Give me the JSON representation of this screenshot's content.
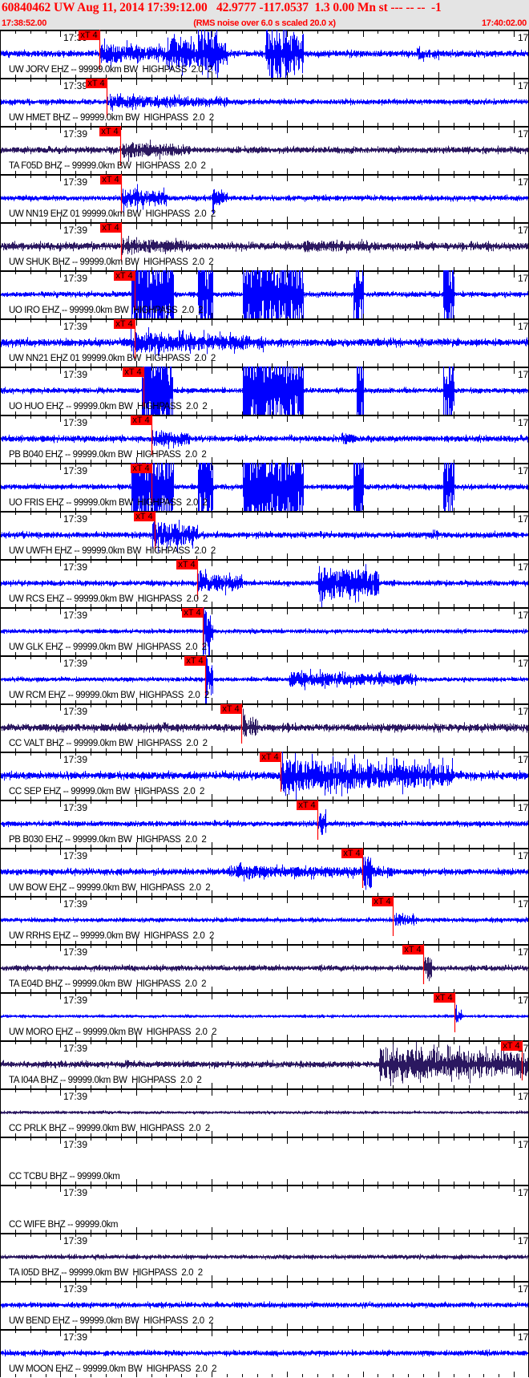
{
  "header": {
    "title": "60840462 UW Aug 11, 2014 17:39:12.00   42.9777 -117.0537  1.3 0.00 Mn st --- -- --  -1",
    "start_time": "17:38:52.00",
    "end_time": "17:40:02.00",
    "rms_note": "(RMS noise over 6.0 s scaled 20.0 x)"
  },
  "colors": {
    "blue": "#0000ff",
    "dark": "#2b1860",
    "pick": "#ff0000",
    "header_bg": "#e4e4e4"
  },
  "chart_data": {
    "type": "line",
    "title": "60840462 UW Aug 11, 2014 17:39:12.00",
    "x_range_seconds": [
      0,
      70
    ],
    "x_start": "17:38:52.00",
    "x_end": "17:40:02.00",
    "tick_major_seconds": 10,
    "tick_minor_seconds": 2,
    "minute_label": "17:39",
    "minute_label_right": "17",
    "pick_label": "xT 4",
    "stations": [
      {
        "label": "UW JORV EHZ -- 99999.0km BW  HIGHPASS  2.0  2",
        "color": "blue",
        "pick": 13.0,
        "noise": 0.12,
        "bursts": [
          [
            13,
            22,
            0.5
          ],
          [
            22,
            30,
            0.8
          ],
          [
            26,
            29,
            1.5
          ],
          [
            35,
            40,
            1.5
          ],
          [
            55,
            58,
            0.3
          ]
        ]
      },
      {
        "label": "UW HMET BHZ -- 99999.0km BW  HIGHPASS  2.0  2",
        "color": "blue",
        "pick": 14.0,
        "noise": 0.1,
        "bursts": [
          [
            14,
            30,
            0.3
          ]
        ]
      },
      {
        "label": "TA F05D BHZ -- 99999.0km BW  HIGHPASS  2.0  2",
        "color": "dark",
        "pick": 15.8,
        "noise": 0.12,
        "bursts": [
          [
            16,
            25,
            0.4
          ]
        ]
      },
      {
        "label": "UW NN19 EHZ 01 99999.0km BW  HIGHPASS  2.0  2",
        "color": "blue",
        "pick": 15.9,
        "noise": 0.1,
        "bursts": [
          [
            16,
            22,
            0.5
          ],
          [
            28,
            30,
            0.5
          ]
        ]
      },
      {
        "label": "UW SHUK BHZ -- 99999.0km BW  HIGHPASS  2.0  2",
        "color": "dark",
        "pick": 15.9,
        "noise": 0.15,
        "bursts": [
          [
            16,
            25,
            0.4
          ],
          [
            40,
            50,
            0.3
          ]
        ]
      },
      {
        "label": "UO IRO EHZ -- 99999.0km BW  HIGHPASS  2.0  2",
        "color": "blue",
        "pick": 17.7,
        "noise": 0.1,
        "bursts": [
          [
            17.2,
            22.9,
            3
          ],
          [
            26,
            28,
            3
          ],
          [
            32,
            40,
            3
          ],
          [
            46.6,
            48,
            3
          ],
          [
            58.5,
            60,
            3
          ]
        ]
      },
      {
        "label": "UW NN21 EHZ 01 99999.0km BW  HIGHPASS  2.0  2",
        "color": "blue",
        "pick": 17.7,
        "noise": 0.15,
        "bursts": [
          [
            17,
            35,
            0.5
          ]
        ]
      },
      {
        "label": "UO HUO EHZ -- 99999.0km BW  HIGHPASS  2.0  2",
        "color": "blue",
        "pick": 18.9,
        "noise": 0.1,
        "bursts": [
          [
            18.6,
            22.7,
            3
          ],
          [
            32,
            40,
            3
          ],
          [
            47,
            48,
            3
          ],
          [
            58.5,
            60,
            3
          ]
        ]
      },
      {
        "label": "PB B040 EHZ -- 99999.0km BW  HIGHPASS  2.0  2",
        "color": "blue",
        "pick": 19.9,
        "noise": 0.12,
        "bursts": [
          [
            20,
            25,
            0.4
          ],
          [
            45,
            47,
            0.3
          ]
        ]
      },
      {
        "label": "UO FRIS EHZ -- 99999.0km BW  HIGHPASS  2.0  2",
        "color": "blue",
        "pick": 19.9,
        "noise": 0.1,
        "bursts": [
          [
            17.2,
            22.9,
            3
          ],
          [
            26,
            28,
            3
          ],
          [
            32,
            40,
            3
          ],
          [
            46.6,
            48,
            3
          ],
          [
            58.5,
            60,
            3
          ]
        ]
      },
      {
        "label": "UW UWFH EHZ -- 99999.0km BW  HIGHPASS  2.0  2",
        "color": "blue",
        "pick": 20.4,
        "noise": 0.12,
        "bursts": [
          [
            20,
            26,
            0.7
          ],
          [
            57,
            58,
            0.3
          ]
        ]
      },
      {
        "label": "UW RCS EHZ -- 99999.0km BW  HIGHPASS  2.0  2",
        "color": "blue",
        "pick": 26.0,
        "noise": 0.1,
        "bursts": [
          [
            26,
            32,
            0.5
          ],
          [
            42,
            50,
            0.9
          ]
        ]
      },
      {
        "label": "UW GLK EHZ -- 99999.0km BW  HIGHPASS  2.0  2",
        "color": "blue",
        "pick": 26.7,
        "noise": 0.08,
        "bursts": [
          [
            26.7,
            28,
            1.3
          ]
        ]
      },
      {
        "label": "UW RCM EHZ -- 99999.0km BW  HIGHPASS  2.0  2",
        "color": "blue",
        "pick": 27.0,
        "noise": 0.08,
        "bursts": [
          [
            27,
            28,
            1.3
          ],
          [
            38,
            55,
            0.35
          ]
        ]
      },
      {
        "label": "CC VALT BHZ -- 99999.0km BW  HIGHPASS  2.0  2",
        "color": "dark",
        "pick": 31.8,
        "noise": 0.15,
        "bursts": [
          [
            32,
            34,
            0.6
          ]
        ]
      },
      {
        "label": "CC SEP EHZ -- 99999.0km BW  HIGHPASS  2.0  2",
        "color": "blue",
        "pick": 37.0,
        "noise": 0.15,
        "bursts": [
          [
            37,
            60,
            0.8
          ]
        ]
      },
      {
        "label": "PB B030 EHZ -- 99999.0km BW  HIGHPASS  2.0  2",
        "color": "blue",
        "pick": 41.9,
        "noise": 0.1,
        "bursts": [
          [
            42,
            43,
            0.7
          ]
        ]
      },
      {
        "label": "UW BOW EHZ -- 99999.0km BW  HIGHPASS  2.0  2",
        "color": "blue",
        "pick": 47.8,
        "noise": 0.12,
        "bursts": [
          [
            30,
            52,
            0.3
          ],
          [
            47.8,
            49,
            1.3
          ]
        ]
      },
      {
        "label": "UW RRHS EHZ -- 99999.0km BW  HIGHPASS  2.0  2",
        "color": "blue",
        "pick": 51.9,
        "noise": 0.08,
        "bursts": [
          [
            52,
            55,
            0.3
          ]
        ]
      },
      {
        "label": "TA E04D BHZ -- 99999.0km BW  HIGHPASS  2.0  2",
        "color": "dark",
        "pick": 55.9,
        "noise": 0.1,
        "bursts": [
          [
            56,
            57,
            0.7
          ]
        ]
      },
      {
        "label": "UW MORO EHZ -- 99999.0km BW  HIGHPASS  2.0  2",
        "color": "blue",
        "pick": 60.0,
        "noise": 0.05,
        "bursts": [
          [
            60,
            61,
            0.4
          ]
        ]
      },
      {
        "label": "TA I04A BHZ -- 99999.0km BW  HIGHPASS  2.0  2",
        "color": "dark",
        "pick": 68.9,
        "noise": 0.12,
        "bursts": [
          [
            50,
            70,
            0.8
          ]
        ]
      },
      {
        "label": "CC PRLK BHZ -- 99999.0km BW  HIGHPASS  2.0  2",
        "color": "dark",
        "pick": null,
        "noise": 0.05,
        "bursts": []
      },
      {
        "label": "CC TCBU BHZ -- 99999.0km",
        "color": "dark",
        "pick": null,
        "noise": 0,
        "bursts": []
      },
      {
        "label": "CC WIFE BHZ -- 99999.0km",
        "color": "dark",
        "pick": null,
        "noise": 0,
        "bursts": []
      },
      {
        "label": "TA I05D BHZ -- 99999.0km BW  HIGHPASS  2.0  2",
        "color": "dark",
        "pick": null,
        "noise": 0.08,
        "bursts": [
          [
            12,
            30,
            0.1
          ]
        ]
      },
      {
        "label": "UW BEND EHZ -- 99999.0km BW  HIGHPASS  2.0  2",
        "color": "blue",
        "pick": null,
        "noise": 0.1,
        "bursts": [
          [
            12,
            30,
            0.1
          ]
        ]
      },
      {
        "label": "UW MOON EHZ -- 99999.0km BW  HIGHPASS  2.0  2",
        "color": "blue",
        "pick": null,
        "noise": 0.1,
        "bursts": []
      }
    ]
  }
}
